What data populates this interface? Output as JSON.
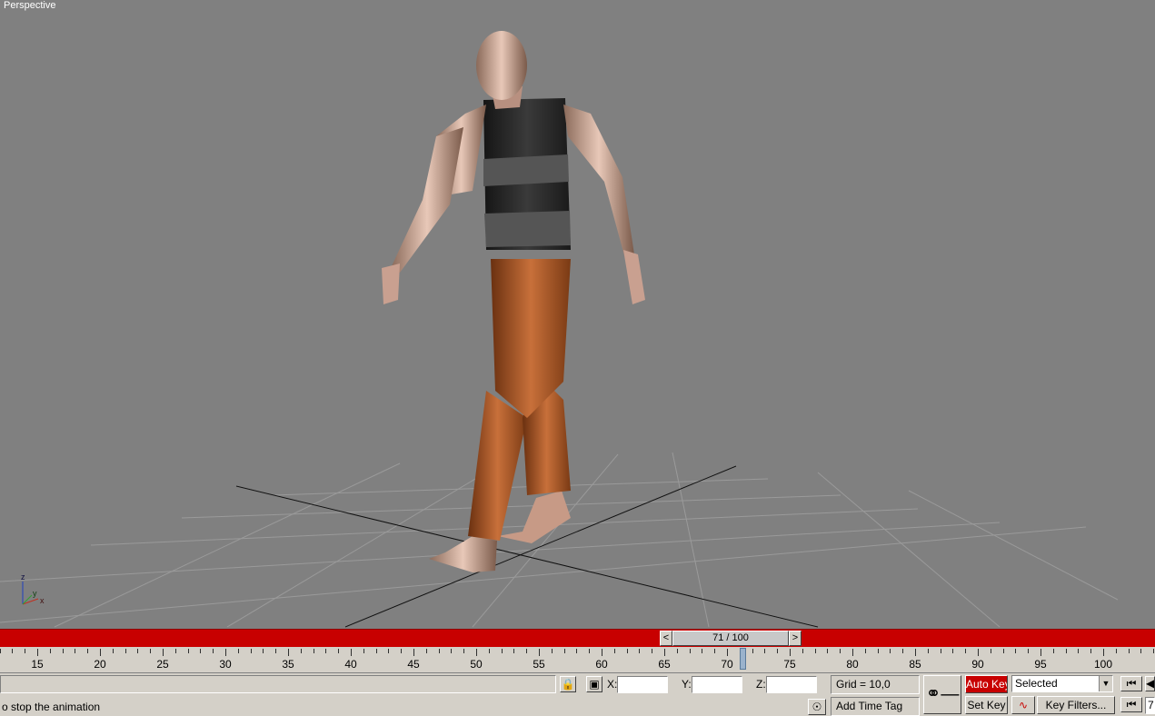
{
  "viewport": {
    "label": "Perspective"
  },
  "axis": {
    "z": "z",
    "y": "y",
    "x": "x"
  },
  "timeslider": {
    "prev": "<",
    "position": "71 / 100",
    "next": ">"
  },
  "ruler": {
    "labels": [
      "15",
      "20",
      "25",
      "30",
      "35",
      "40",
      "45",
      "50",
      "55",
      "60",
      "65",
      "70",
      "75",
      "80",
      "85",
      "90",
      "95",
      "100"
    ]
  },
  "coords": {
    "x_label": "X:",
    "y_label": "Y:",
    "z_label": "Z:",
    "x_value": "",
    "y_value": "",
    "z_value": ""
  },
  "grid": {
    "text": "Grid = 10,0"
  },
  "time_tag": {
    "label": "Add Time Tag"
  },
  "keys": {
    "auto_key": "Auto Key",
    "set_key": "Set Key",
    "key_filters": "Key Filters...",
    "selected": "Selected",
    "frame": "7"
  },
  "status": {
    "prompt": "o stop the animation"
  },
  "colors": {
    "viewport_bg": "#808080",
    "timebar": "#c80000",
    "panel": "#d4d0c8"
  }
}
